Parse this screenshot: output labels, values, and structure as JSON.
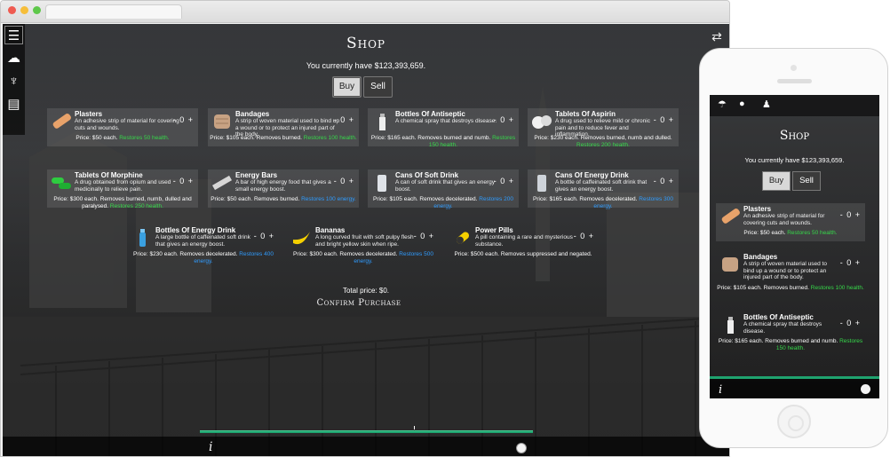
{
  "shop": {
    "title": "Shop",
    "money": "You currently have $123,393,659.",
    "modes": [
      "Buy",
      "Sell"
    ],
    "total": "Total price: $0.",
    "confirm": "Confirm Purchase"
  },
  "items": [
    {
      "name": "Plasters",
      "desc": "An adhesive strip of material for covering cuts and wounds.",
      "qty": "- 0 +",
      "price": "Price: $50 each.",
      "restore": "Restores 50 health.",
      "restore_color": "#36d84a"
    },
    {
      "name": "Bandages",
      "desc": "A strip of woven material used to bind up a wound or to protect an injured part of the body.",
      "qty": "- 0 +",
      "price": "Price: $105 each. Removes burned.",
      "restore": "Restores 100 health.",
      "restore_color": "#36d84a"
    },
    {
      "name": "Bottles Of Antiseptic",
      "desc": "A chemical spray that destroys disease.",
      "qty": "- 0 +",
      "price": "Price: $165 each. Removes burned and numb.",
      "restore": "Restores 150 health.",
      "restore_color": "#36d84a"
    },
    {
      "name": "Tablets Of Aspirin",
      "desc": "A drug used to relieve mild or chronic pain and to reduce fever and inflammation.",
      "qty": "- 0 +",
      "price": "Price: $230 each. Removes burned, numb and dulled.",
      "restore": "Restores 200 health.",
      "restore_color": "#36d84a"
    },
    {
      "name": "Tablets Of Morphine",
      "desc": "A drug obtained from opium and used medicinally to relieve pain.",
      "qty": "- 0 +",
      "price": "Price: $300 each. Removes burned, numb, dulled and paralysed.",
      "restore": "Restores 250 health.",
      "restore_color": "#36d84a"
    },
    {
      "name": "Energy Bars",
      "desc": "A bar of high energy food that gives a small energy boost.",
      "qty": "- 0 +",
      "price": "Price: $50 each. Removes burned.",
      "restore": "Restores 100 energy.",
      "restore_color": "#2f9cff"
    },
    {
      "name": "Cans Of Soft Drink",
      "desc": "A can of soft drink that gives an energy boost.",
      "qty": "- 0 +",
      "price": "Price: $105 each. Removes decelerated.",
      "restore": "Restores 200 energy.",
      "restore_color": "#2f9cff"
    },
    {
      "name": "Cans Of Energy Drink",
      "desc": "A bottle of caffeinated soft drink that gives an energy boost.",
      "qty": "- 0 +",
      "price": "Price: $165 each. Removes decelerated.",
      "restore": "Restores 300 energy.",
      "restore_color": "#2f9cff"
    },
    {
      "name": "Bottles Of Energy Drink",
      "desc": "A large bottle of caffeinated soft drink that gives an energy boost.",
      "qty": "- 0 +",
      "price": "Price: $230 each. Removes decelerated.",
      "restore": "Restores 400 energy.",
      "restore_color": "#2f9cff"
    },
    {
      "name": "Bananas",
      "desc": "A long curved fruit with soft pulpy flesh and bright yellow skin when ripe.",
      "qty": "- 0 +",
      "price": "Price: $300 each. Removes decelerated.",
      "restore": "Restores 500 energy.",
      "restore_color": "#2f9cff"
    },
    {
      "name": "Power Pills",
      "desc": "A pill containing a rare and mysterious substance.",
      "qty": "- 0 +",
      "price": "Price: $500 each. Removes suppressed and negated.",
      "restore": "",
      "restore_color": "#2f9cff"
    }
  ],
  "bottom": {
    "info": "i"
  },
  "icons": {
    "menu": "menu-icon",
    "cloud": "cloud-icon",
    "tree": "tree-icon",
    "map": "map-icon",
    "export": "export-icon",
    "info": "info-icon",
    "ball": "ball-icon",
    "hat": "hat-icon",
    "chat": "chat-icon",
    "user": "user-icon"
  }
}
